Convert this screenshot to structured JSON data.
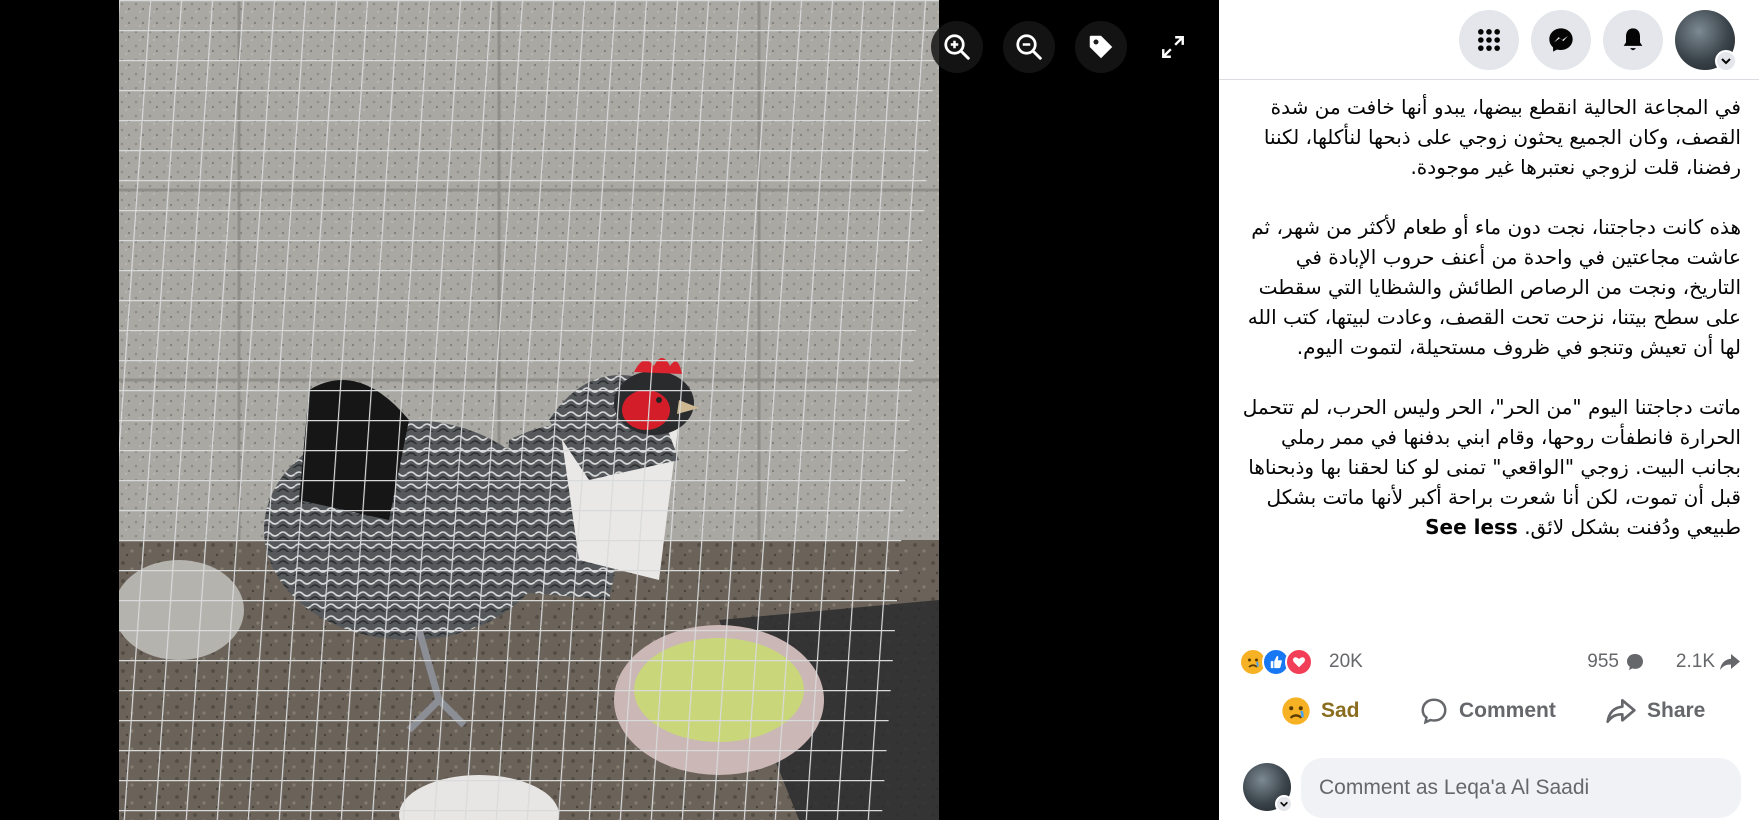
{
  "viewer": {
    "buttons": [
      "zoom-in-icon",
      "zoom-out-icon",
      "tag-icon",
      "fullscreen-icon"
    ]
  },
  "topbar": {
    "icons": [
      "menu-grid-icon",
      "messenger-icon",
      "bell-icon"
    ]
  },
  "post": {
    "paragraphs": [
      "في المجاعة الحالية انقطع بيضها، يبدو أنها خافت من شدة القصف، وكان الجميع يحثون زوجي على ذبحها لنأكلها، لكننا رفضنا، قلت لزوجي نعتبرها غير موجودة.",
      "هذه كانت دجاجتنا، نجت دون ماء أو طعام لأكثر من شهر، ثم عاشت مجاعتين في واحدة من أعنف حروب الإبادة في التاريخ، ونجت من الرصاص الطائش والشظايا التي سقطت على سطح بيتنا، نزحت تحت القصف، وعادت لبيتها، كتب الله لها أن تعيش وتنجو في ظروف مستحيلة، لتموت اليوم.",
      "ماتت دجاجتنا اليوم \"من الحر\"، الحر وليس الحرب، لم تتحمل الحرارة فانطفأت روحها، وقام ابني بدفنها في ممر رملي بجانب البيت. زوجي \"الواقعي\" تمنى لو كنا لحقنا بها وذبحناها قبل أن تموت، لكن أنا شعرت براحة أكبر لأنها ماتت بشكل طبيعي ودُفنت بشكل لائق."
    ],
    "see_less": "See less"
  },
  "reactions": {
    "count": "20K",
    "comments": "955",
    "shares": "2.1K",
    "icons": [
      "sad-emoji-icon",
      "like-icon",
      "love-icon"
    ],
    "colors": {
      "like": "#1877f2",
      "love": "#f33e58",
      "sad": "#f7b125"
    }
  },
  "actions": {
    "sad": "Sad",
    "comment": "Comment",
    "share": "Share"
  },
  "composer": {
    "placeholder": "Comment as Leqa'a Al Saadi"
  }
}
